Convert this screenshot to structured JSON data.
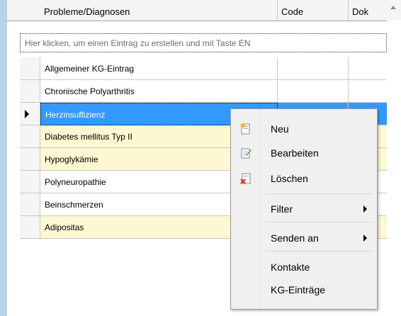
{
  "columns": {
    "problem": "Probleme/Diagnosen",
    "code": "Code",
    "dok": "Dok"
  },
  "new_row_hint": "Hier klicken, um einen Eintrag zu erstellen und mit Taste EN",
  "rows": [
    {
      "label": "Allgemeiner KG-Eintrag"
    },
    {
      "label": "Chronische Polyarthritis"
    },
    {
      "label": "Herzinsuffizienz"
    },
    {
      "label": "Diabetes mellitus Typ II"
    },
    {
      "label": "Hypoglykämie"
    },
    {
      "label": "Polyneuropathie"
    },
    {
      "label": "Beinschmerzen"
    },
    {
      "label": "Adipositas"
    }
  ],
  "context_menu": {
    "new": "Neu",
    "edit": "Bearbeiten",
    "delete": "Löschen",
    "filter": "Filter",
    "send_to": "Senden an",
    "contacts": "Kontakte",
    "kg_entries": "KG-Einträge"
  },
  "colors": {
    "selection": "#3399ff",
    "highlight_row": "#fdf8d2",
    "left_strip": "#b9d1ea"
  }
}
